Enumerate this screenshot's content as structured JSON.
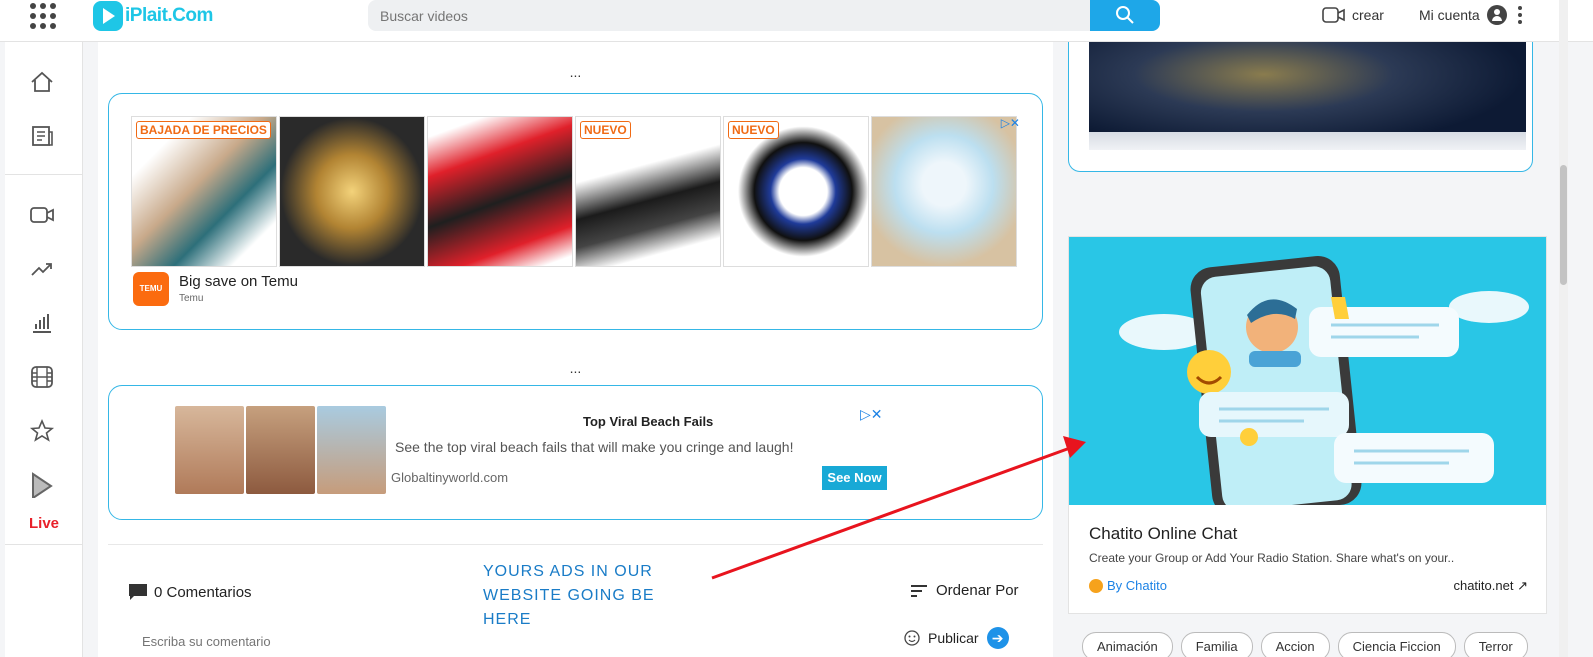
{
  "header": {
    "logo_text": "iPlait.Com",
    "search_placeholder": "Buscar videos",
    "create_label": "crear",
    "account_label": "Mi cuenta"
  },
  "sidebar": {
    "items": [
      "home-icon",
      "news-icon",
      "video-icon",
      "trending-icon",
      "chart-icon",
      "film-icon",
      "star-icon",
      "play-icon"
    ],
    "live_label": "Live"
  },
  "main": {
    "dots_top": "...",
    "dots_mid": "...",
    "ad1": {
      "badges": [
        "BAJADA DE PRECIOS",
        "",
        "",
        "NUEVO",
        "NUEVO",
        ""
      ],
      "brand_logo": "TEMU",
      "title": "Big save on Temu",
      "subtitle": "Temu"
    },
    "ad2": {
      "title": "Top Viral Beach Fails",
      "description": "See the top viral beach fails that will make you cringe and laugh!",
      "domain": "Globaltinyworld.com",
      "button": "See Now"
    },
    "comments_label": "0 Comentarios",
    "annotation": "YOURS ADS IN OUR WEBSITE GOING BE HERE",
    "order_label": "Ordenar Por",
    "comment_placeholder": "Escriba su comentario",
    "publish_label": "Publicar"
  },
  "right": {
    "chat_card": {
      "title": "Chatito Online Chat",
      "description": "Create your Group or Add Your Radio Station. Share what's on your..",
      "by": "By Chatito",
      "domain": "chatito.net"
    },
    "tags": [
      "Animación",
      "Familia",
      "Accion",
      "Ciencia Ficcion",
      "Terror"
    ]
  },
  "colors": {
    "accent": "#1ea7e8",
    "ad_border": "#35b7e6",
    "arrow": "#e8141e",
    "live": "#e8202a"
  }
}
